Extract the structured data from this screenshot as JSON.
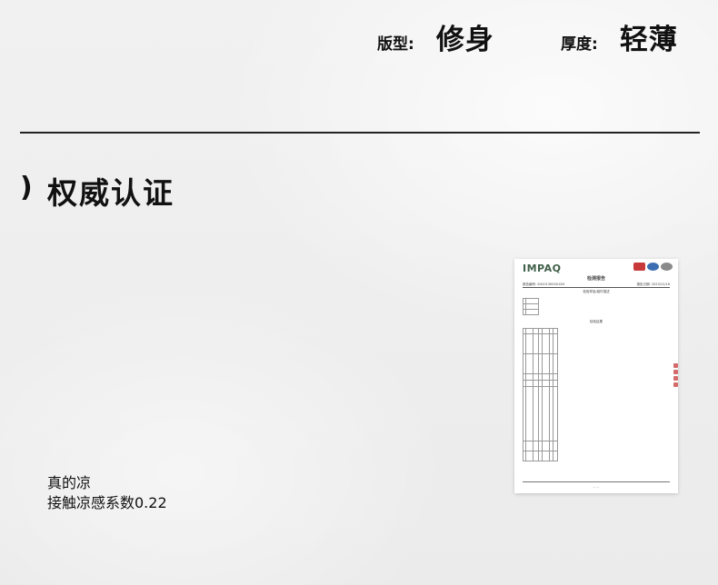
{
  "specs": {
    "fit_label": "版型:",
    "fit_value": "修身",
    "thickness_label": "厚度:",
    "thickness_value": "轻薄"
  },
  "section": {
    "marker": ")",
    "title": "权威认证"
  },
  "caption": {
    "line1": "真的凉",
    "line2": "接触凉感系数0.22"
  },
  "certificate": {
    "logo": "IMPAQ",
    "title": "检测报告",
    "report_no": "报告编号: SH2013000012N",
    "report_date": "报告日期: 2023/12/16",
    "samples_heading": "检验样品/组件描述",
    "results_heading": "检验结果",
    "accent_red": "#c83a3a",
    "accent_blue": "#3b6fb1"
  }
}
